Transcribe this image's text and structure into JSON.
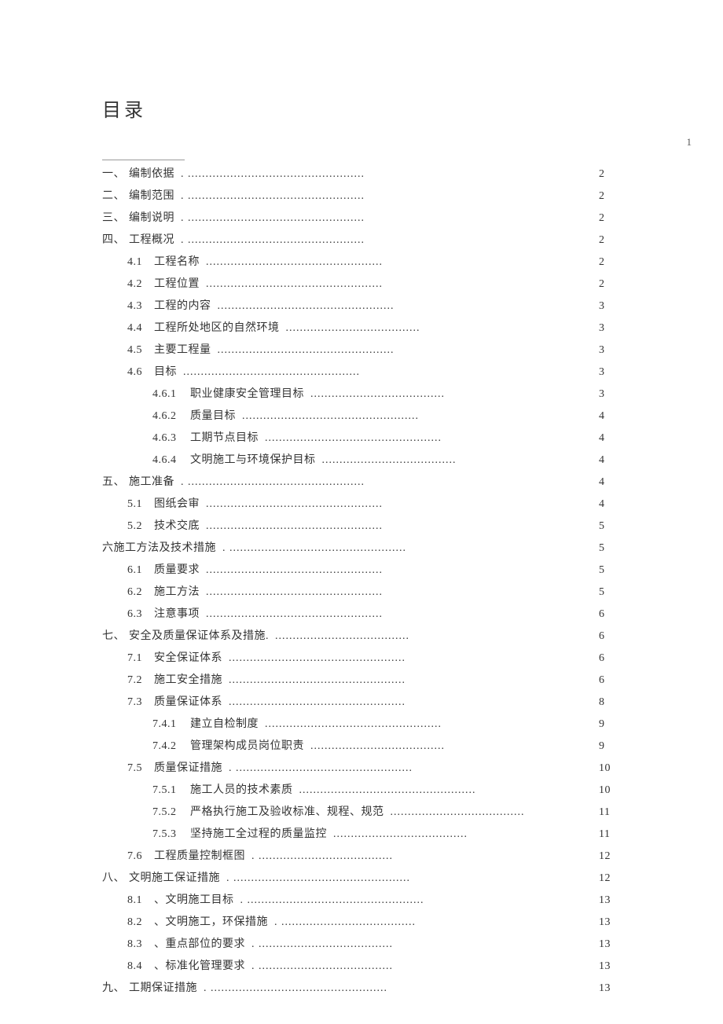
{
  "title": "目录",
  "top_page_number": "1",
  "toc": [
    {
      "level": 0,
      "num": "一、",
      "label": "编制依据",
      "dots": ".",
      "page": "2"
    },
    {
      "level": 0,
      "num": "二、",
      "label": "编制范围",
      "dots": ".",
      "page": "2"
    },
    {
      "level": 0,
      "num": "三、",
      "label": "编制说明",
      "dots": ".",
      "page": "2"
    },
    {
      "level": 0,
      "num": "四、",
      "label": "工程概况",
      "dots": ".",
      "page": "2"
    },
    {
      "level": 1,
      "num": "4.1",
      "label": "工程名称",
      "dots": "",
      "page": "2"
    },
    {
      "level": 1,
      "num": "4.2",
      "label": "工程位置",
      "dots": "",
      "page": "2"
    },
    {
      "level": 1,
      "num": "4.3",
      "label": "工程的内容",
      "dots": "",
      "page": "3"
    },
    {
      "level": 1,
      "num": "4.4",
      "label": "工程所处地区的自然环境",
      "dots": "",
      "page": "3"
    },
    {
      "level": 1,
      "num": "4.5",
      "label": "主要工程量",
      "dots": "",
      "page": "3"
    },
    {
      "level": 1,
      "num": "4.6",
      "label": "目标",
      "dots": "",
      "page": "3"
    },
    {
      "level": 2,
      "num": "4.6.1",
      "label": "职业健康安全管理目标",
      "dots": "",
      "page": "3"
    },
    {
      "level": 2,
      "num": "4.6.2",
      "label": "质量目标",
      "dots": "",
      "page": "4"
    },
    {
      "level": 2,
      "num": "4.6.3",
      "label": "工期节点目标",
      "dots": "",
      "page": "4"
    },
    {
      "level": 2,
      "num": "4.6.4",
      "label": "文明施工与环境保护目标",
      "dots": "",
      "page": "4"
    },
    {
      "level": 0,
      "num": "五、",
      "label": "施工准备",
      "dots": ".",
      "page": "4"
    },
    {
      "level": 1,
      "num": "5.1",
      "label": "图纸会审",
      "dots": "",
      "page": "4"
    },
    {
      "level": 1,
      "num": "5.2",
      "label": "技术交底",
      "dots": "",
      "page": "5"
    },
    {
      "level": 0,
      "num": "",
      "label": "六施工方法及技术措施",
      "dots": ".",
      "page": "5"
    },
    {
      "level": 1,
      "num": "6.1",
      "label": "质量要求",
      "dots": "",
      "page": "5"
    },
    {
      "level": 1,
      "num": "6.2",
      "label": "施工方法",
      "dots": "",
      "page": "5"
    },
    {
      "level": 1,
      "num": "6.3",
      "label": "注意事项",
      "dots": "",
      "page": "6"
    },
    {
      "level": 0,
      "num": "七、",
      "label": "安全及质量保证体系及措施.",
      "dots": "",
      "page": "6"
    },
    {
      "level": 1,
      "num": "7.1",
      "label": "安全保证体系",
      "dots": "",
      "page": "6"
    },
    {
      "level": 1,
      "num": "7.2",
      "label": "施工安全措施",
      "dots": "",
      "page": "6"
    },
    {
      "level": 1,
      "num": "7.3",
      "label": "质量保证体系",
      "dots": "",
      "page": "8"
    },
    {
      "level": 2,
      "num": "7.4.1",
      "label": "建立自检制度",
      "dots": "",
      "page": "9"
    },
    {
      "level": 2,
      "num": "7.4.2",
      "label": "管理架构成员岗位职责",
      "dots": "",
      "page": "9"
    },
    {
      "level": 1,
      "num": "7.5",
      "label": "质量保证措施",
      "dots": ".",
      "page": "10"
    },
    {
      "level": 2,
      "num": "7.5.1",
      "label": "施工人员的技术素质",
      "dots": "",
      "page": "10"
    },
    {
      "level": 2,
      "num": "7.5.2",
      "label": "严格执行施工及验收标准、规程、规范",
      "dots": "",
      "page": "11"
    },
    {
      "level": 2,
      "num": "7.5.3",
      "label": "坚持施工全过程的质量监控",
      "dots": "",
      "page": "11"
    },
    {
      "level": 1,
      "num": "7.6",
      "label": "工程质量控制框图",
      "dots": ".",
      "page": "12"
    },
    {
      "level": 0,
      "num": "八、",
      "label": "文明施工保证措施",
      "dots": ".",
      "page": "12"
    },
    {
      "level": 1,
      "num": "8.1",
      "label": "、文明施工目标",
      "dots": ".",
      "page": "13"
    },
    {
      "level": 1,
      "num": "8.2",
      "label": "、文明施工，环保措施",
      "dots": ".",
      "page": "13"
    },
    {
      "level": 1,
      "num": "8.3",
      "label": "、重点部位的要求",
      "dots": ".",
      "page": "13"
    },
    {
      "level": 1,
      "num": "8.4",
      "label": "、标准化管理要求",
      "dots": ".",
      "page": "13"
    },
    {
      "level": 0,
      "num": "九、",
      "label": "工期保证措施",
      "dots": ".",
      "page": "13"
    }
  ],
  "dots_long": "................................................................",
  "dots_med": "..................................................",
  "dots_short": "......................................"
}
